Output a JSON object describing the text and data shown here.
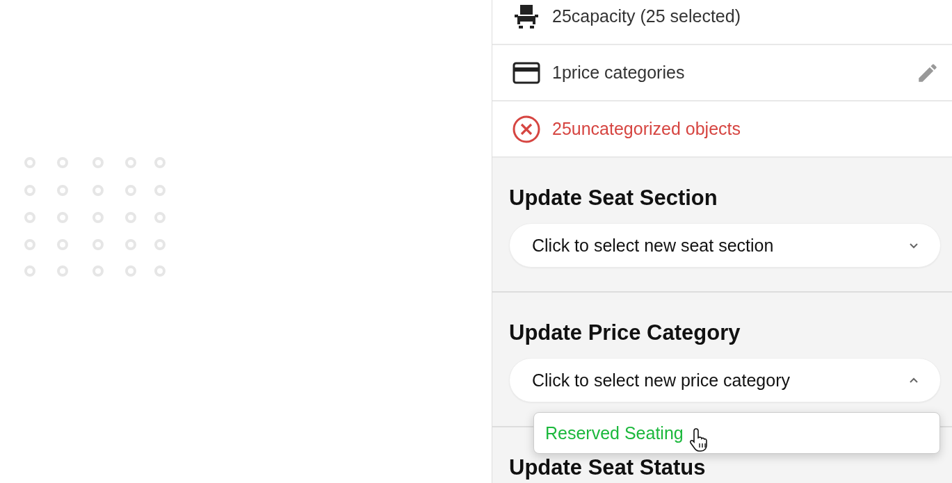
{
  "summary_rows": [
    {
      "kind": "capacity",
      "text": "25capacity (25 selected)",
      "editable": false
    },
    {
      "kind": "price",
      "text": "1price categories",
      "editable": true
    },
    {
      "kind": "error",
      "text": "25uncategorized objects",
      "editable": false
    }
  ],
  "sections": [
    {
      "title": "Update Seat Section",
      "select": {
        "placeholder": "Click to select new seat section",
        "expanded": false
      }
    },
    {
      "title": "Update Price Category",
      "select": {
        "placeholder": "Click to select new price category",
        "expanded": true,
        "options": [
          {
            "label": "Reserved Seating",
            "hovered": true
          }
        ]
      }
    },
    {
      "title": "Update Seat Status"
    }
  ]
}
